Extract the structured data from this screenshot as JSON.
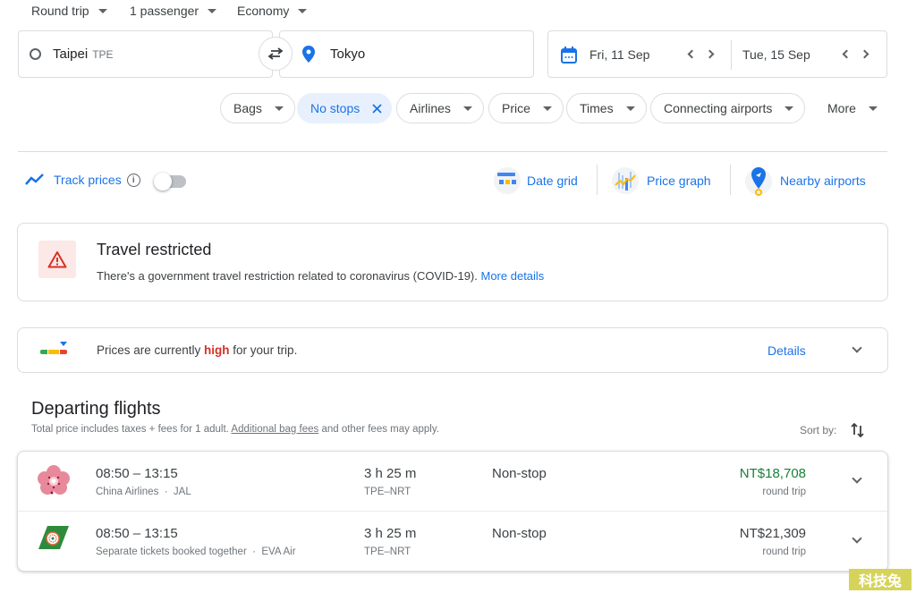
{
  "search": {
    "trip_type": "Round trip",
    "passengers": "1 passenger",
    "cabin": "Economy",
    "origin_city": "Taipei",
    "origin_code": "TPE",
    "destination": "Tokyo",
    "depart_date": "Fri, 11 Sep",
    "return_date": "Tue, 15 Sep"
  },
  "filters": [
    {
      "label": "Bags",
      "active": false
    },
    {
      "label": "No stops",
      "active": true
    },
    {
      "label": "Airlines",
      "active": false
    },
    {
      "label": "Price",
      "active": false
    },
    {
      "label": "Times",
      "active": false
    },
    {
      "label": "Connecting airports",
      "active": false
    },
    {
      "label": "More",
      "active": false
    }
  ],
  "tools": {
    "track_prices": "Track prices",
    "track_enabled": false,
    "date_grid": "Date grid",
    "price_graph": "Price graph",
    "nearby_airports": "Nearby airports"
  },
  "restriction": {
    "title": "Travel restricted",
    "body": "There's a government travel restriction related to coronavirus (COVID-19).",
    "link": "More details"
  },
  "price_insight": {
    "prefix": "Prices are currently ",
    "level": "high",
    "suffix": " for your trip.",
    "details": "Details",
    "level_color": "#d93025"
  },
  "results": {
    "title": "Departing flights",
    "note_prefix": "Total price includes taxes + fees for 1 adult. ",
    "note_link": "Additional bag fees",
    "note_suffix": " and other fees may apply.",
    "sort_label": "Sort by:",
    "flights": [
      {
        "times": "08:50 – 13:15",
        "airlines": "China Airlines  ·  JAL",
        "duration": "3 h 25 m",
        "route": "TPE–NRT",
        "stops": "Non-stop",
        "price": "NT$18,708",
        "price_note": "round trip",
        "price_color": "#188038"
      },
      {
        "times": "08:50 – 13:15",
        "airlines": "Separate tickets booked together  ·  EVA Air",
        "duration": "3 h 25 m",
        "route": "TPE–NRT",
        "stops": "Non-stop",
        "price": "NT$21,309",
        "price_note": "round trip",
        "price_color": "#3c4043"
      }
    ]
  },
  "watermark": "科技兔",
  "colors": {
    "accent": "#1a73e8",
    "chip_active_bg": "#e8f0fe"
  }
}
